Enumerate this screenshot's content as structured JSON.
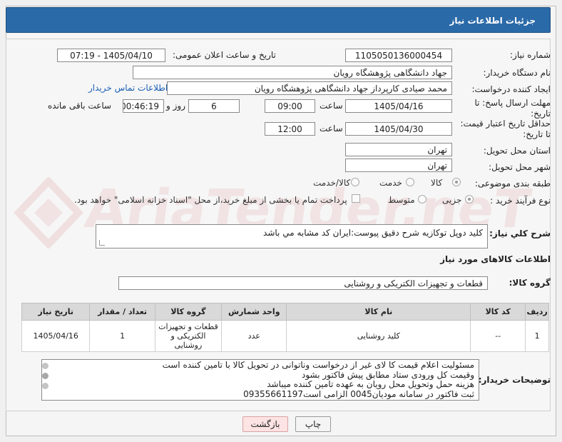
{
  "window": {
    "title": "جزئیات اطلاعات نیاز"
  },
  "form": {
    "need_number": {
      "label": "شماره نیاز:",
      "value": "1105050136000454"
    },
    "announce": {
      "label": "تاریخ و ساعت اعلان عمومی:",
      "value": "1405/04/10 - 07:19"
    },
    "buyer_org": {
      "label": "نام دستگاه خریدار:",
      "value": "جهاد دانشگاهی پژوهشگاه رویان"
    },
    "requester": {
      "label": "ایجاد کننده درخواست:",
      "value": "محمد صیادی کارپرداز جهاد دانشگاهی پژوهشگاه رویان",
      "contact_link": "اطلاعات تماس خریدار"
    },
    "deadline": {
      "label_line1": "مهلت ارسال پاسخ: تا",
      "label_line2": "تاریخ:",
      "date": "1405/04/16",
      "time_label": "ساعت",
      "time": "09:00",
      "days": "6",
      "days_label": "روز و",
      "remaining": "00:46:19",
      "remaining_label": "ساعت باقی مانده"
    },
    "price_validity": {
      "label_line1": "حداقل تاریخ اعتبار قیمت:",
      "label_line2": "تا تاریخ:",
      "date": "1405/04/30",
      "time_label": "ساعت",
      "time": "12:00"
    },
    "delivery_province": {
      "label": "استان محل تحویل:",
      "value": "تهران"
    },
    "delivery_city": {
      "label": "شهر محل تحویل:",
      "value": "تهران"
    },
    "category": {
      "label": "طبقه بندی موضوعی:",
      "options": [
        "کالا",
        "خدمت",
        "کالا/خدمت"
      ],
      "selected": "کالا"
    },
    "purchase_type": {
      "label": "نوع فرآیند خرید :",
      "options": [
        "جزیی",
        "متوسط"
      ],
      "selected": "جزیی",
      "checkbox_text": "پرداخت تمام یا بخشی از مبلغ خرید،از محل \"اسناد خزانه اسلامی\" خواهد بود."
    },
    "overall_desc": {
      "label": "شرح کلي نياز:",
      "value": "کليد دوپل توکازيه شرح دقيق پيوست:ايران کد مشابه مي باشد"
    }
  },
  "goods": {
    "section_title": "اطلاعات کالاهای مورد نیاز",
    "group_label": "گروه کالا:",
    "group_value": "قطعات و تجهیزات الکتریکی و روشنایی",
    "columns": [
      "ردیف",
      "کد کالا",
      "نام کالا",
      "واحد شمارش",
      "گروه کالا",
      "تعداد / مقدار",
      "تاریخ نیاز"
    ],
    "rows": [
      {
        "row": "1",
        "code": "--",
        "name": "کلید روشنایی",
        "unit": "عدد",
        "group": "قطعات و تجهیزات الکتریکی و روشنایی",
        "qty": "1",
        "date": "1405/04/16"
      }
    ]
  },
  "buyer_notes": {
    "label": "توضیحات خریدار:",
    "lines": [
      "مسئولیت اعلام قیمت کا لای  غیر از درخواست وناتوانی در تحویل کالا با تامین کننده است",
      "وقیمت کل ورودی ستاد مطابق پیش فاکتور بشود",
      "هزینه حمل وتحویل محل رویان به عهده تامین کننده میباشد",
      "ثبت فاکتور در سامانه مودیان0045 الزامی است09355661197"
    ]
  },
  "actions": {
    "print": "چاپ",
    "back": "بازگشت"
  },
  "watermark": "AriaTender.neT"
}
